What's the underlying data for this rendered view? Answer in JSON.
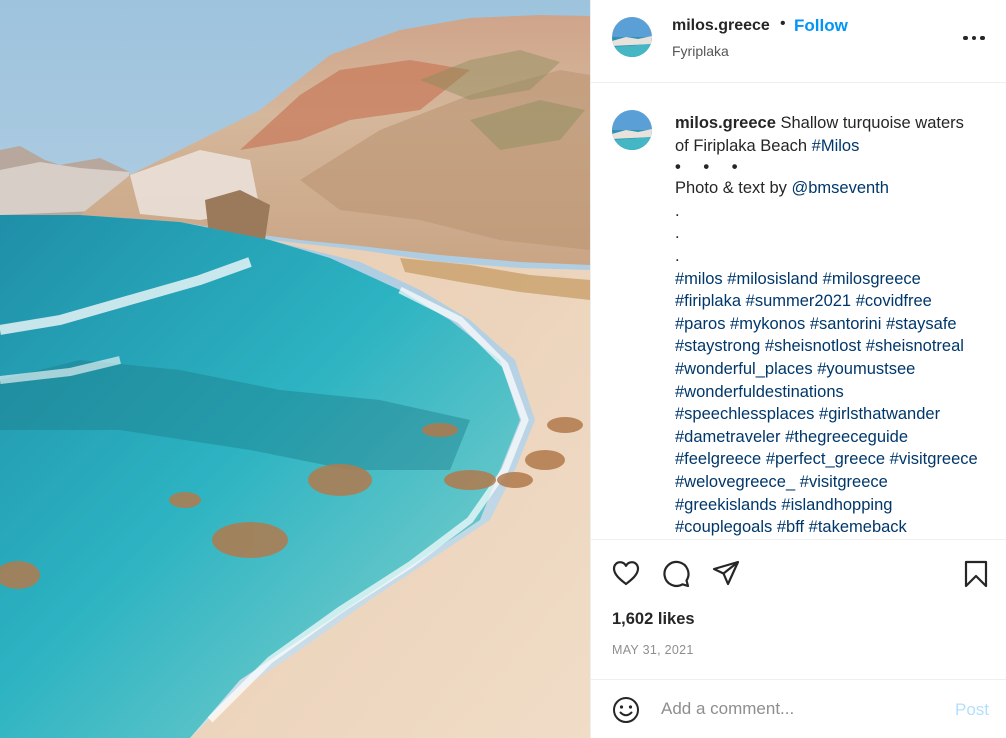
{
  "post": {
    "username": "milos.greece",
    "follow_label": "Follow",
    "separator": "•",
    "location": "Fyriplaka",
    "more_icon": "more-horizontal-icon",
    "photo_description": "beach-cliffs-photo"
  },
  "caption": {
    "username": "milos.greece",
    "line1_text": "Shallow turquoise waters",
    "line2_text": "of Firiplaka Beach ",
    "line2_tag": "#Milos",
    "dots": "• • •",
    "credit_text": "Photo & text by ",
    "credit_handle": "@bmseventh",
    "period_1": ".",
    "period_2": ".",
    "period_3": ".",
    "hashtag_lines": [
      [
        "#milos",
        "#milosisland",
        "#milosgreece"
      ],
      [
        "#firiplaka",
        "#summer2021",
        "#covidfree"
      ],
      [
        "#paros",
        "#mykonos",
        "#santorini",
        "#staysafe"
      ],
      [
        "#staystrong",
        "#sheisnotlost",
        "#sheisnotreal"
      ],
      [
        "#wonderful_places",
        "#youmustsee"
      ],
      [
        "#wonderfuldestinations"
      ],
      [
        "#speechlessplaces",
        "#girlsthatwander"
      ],
      [
        "#dametraveler",
        "#thegreeceguide"
      ],
      [
        "#feelgreece",
        "#perfect_greece",
        "#visitgreece"
      ],
      [
        "#welovegreece_",
        "#visitgreece"
      ],
      [
        "#greekislands",
        "#islandhopping"
      ],
      [
        "#couplegoals",
        "#bff",
        "#takemeback"
      ]
    ]
  },
  "actions": {
    "like_icon": "heart-icon",
    "comment_icon": "comment-bubble-icon",
    "share_icon": "paper-plane-icon",
    "save_icon": "bookmark-icon",
    "likes_text": "1,602 likes",
    "date_text": "MAY 31, 2021"
  },
  "comment": {
    "emoji_icon": "smiley-icon",
    "placeholder": "Add a comment...",
    "post_label": "Post"
  },
  "colors": {
    "accent": "#0095f6",
    "hashtag": "#00376b",
    "post_disabled": "#b2dffc",
    "muted": "#8e8e8e"
  }
}
